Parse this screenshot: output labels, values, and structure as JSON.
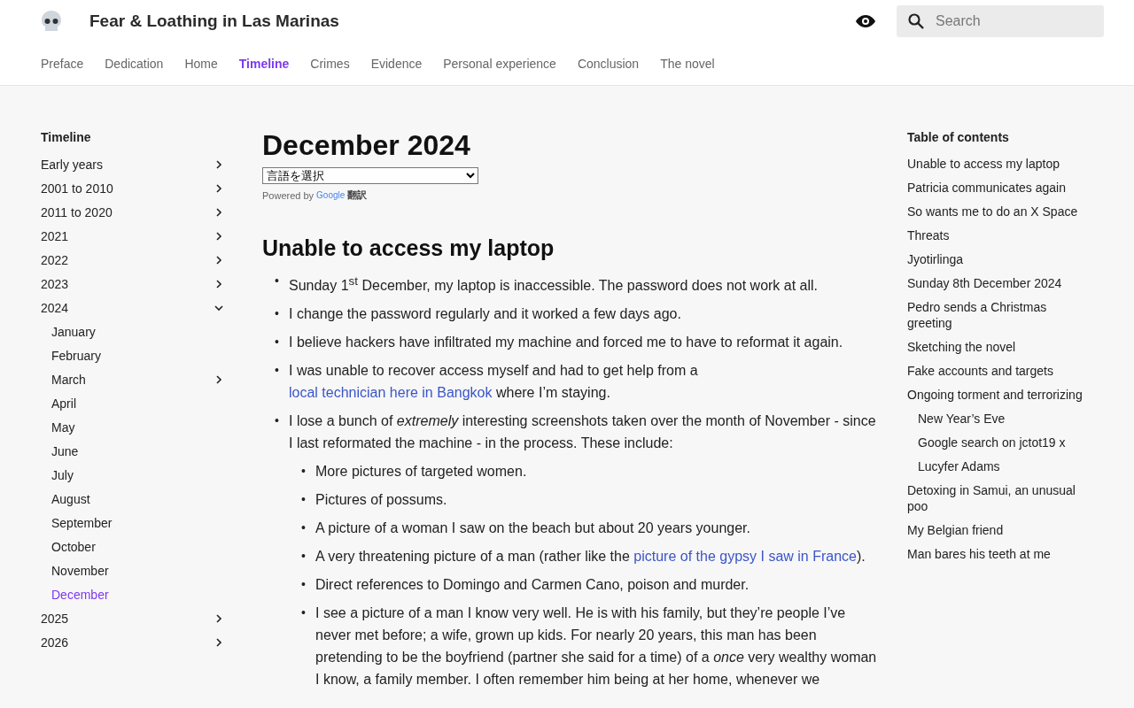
{
  "site": {
    "title": "Fear & Loathing in Las Marinas",
    "search": {
      "placeholder": "Search"
    }
  },
  "nav": [
    {
      "label": "Preface",
      "selected": false
    },
    {
      "label": "Dedication",
      "selected": false
    },
    {
      "label": "Home",
      "selected": false
    },
    {
      "label": "Timeline",
      "selected": true
    },
    {
      "label": "Crimes",
      "selected": false
    },
    {
      "label": "Evidence",
      "selected": false
    },
    {
      "label": "Personal experience",
      "selected": false
    },
    {
      "label": "Conclusion",
      "selected": false
    },
    {
      "label": "The novel",
      "selected": false
    }
  ],
  "sidebar": {
    "title": "Timeline",
    "items": [
      {
        "label": "Early years",
        "expanded": false,
        "selected": false
      },
      {
        "label": "2001 to 2010",
        "expanded": false,
        "selected": false
      },
      {
        "label": "2011 to 2020",
        "expanded": false,
        "selected": false
      },
      {
        "label": "2021",
        "expanded": false,
        "selected": false
      },
      {
        "label": "2022",
        "expanded": false,
        "selected": false
      },
      {
        "label": "2023",
        "expanded": false,
        "selected": false
      },
      {
        "label": "2024",
        "expanded": true,
        "selected": false,
        "children": [
          {
            "label": "January",
            "selected": false
          },
          {
            "label": "February",
            "selected": false
          },
          {
            "label": "March",
            "expanded": false,
            "selected": false
          },
          {
            "label": "April",
            "selected": false
          },
          {
            "label": "May",
            "selected": false
          },
          {
            "label": "June",
            "selected": false
          },
          {
            "label": "July",
            "selected": false
          },
          {
            "label": "August",
            "selected": false
          },
          {
            "label": "September",
            "selected": false
          },
          {
            "label": "October",
            "selected": false
          },
          {
            "label": "November",
            "selected": false
          },
          {
            "label": "December",
            "selected": true
          }
        ]
      },
      {
        "label": "2025",
        "expanded": false,
        "selected": false
      },
      {
        "label": "2026",
        "expanded": false,
        "selected": false
      }
    ]
  },
  "article": {
    "title": "December 2024",
    "translate": {
      "select": "言語を選択",
      "powered_by": "Powered by",
      "google": "Google",
      "translate_label": "翻訳"
    },
    "section_title": "Unable to access my laptop",
    "bullets": [
      {
        "marker": "•",
        "parts": [
          {
            "kind": "text",
            "text": "Sunday 1$^{st}$ December, my laptop is inaccessible. The password does not work at all."
          }
        ]
      },
      {
        "marker": "•",
        "parts": [
          {
            "kind": "text",
            "text": "I change the password regularly and it worked a few days ago."
          }
        ]
      },
      {
        "marker": "•",
        "parts": [
          {
            "kind": "text",
            "text": "I believe hackers have infiltrated my machine and forced me to have to reformat it again."
          }
        ]
      },
      {
        "marker": "•",
        "parts": [
          {
            "kind": "text",
            "text": "I was unable to recover access myself and had to get help from a"
          },
          {
            "kind": "link",
            "text": "local technician here in Bangkok"
          },
          {
            "kind": "text",
            "text": "where I’m staying."
          }
        ]
      },
      {
        "marker": "•",
        "parts": [
          {
            "kind": "text",
            "text": "I lose a bunch of *extremely* interesting screenshots taken over the month of November - since I last reformated the machine - in the process. These include:"
          }
        ],
        "children": [
          {
            "marker": "•",
            "parts": [
              {
                "kind": "text",
                "text": "More pictures of targeted women."
              }
            ]
          },
          {
            "marker": "•",
            "parts": [
              {
                "kind": "text",
                "text": "Pictures of possums."
              }
            ]
          },
          {
            "marker": "•",
            "parts": [
              {
                "kind": "text",
                "text": "A picture of a woman I saw on the beach but about 20 years younger."
              }
            ]
          },
          {
            "marker": "•",
            "parts": [
              {
                "kind": "text",
                "text": "A very threatening picture of a man (rather like the"
              },
              {
                "kind": "link",
                "text": "picture of the gypsy I saw in France"
              },
              {
                "kind": "text",
                "text": ")."
              }
            ]
          },
          {
            "marker": "•",
            "parts": [
              {
                "kind": "text",
                "text": "Direct references to Domingo and Carmen Cano, poison and murder."
              }
            ]
          },
          {
            "marker": "•",
            "parts": [
              {
                "kind": "text",
                "text": "I see a picture of a man I know very well. He is with his family, but they’re people I’ve never met before; a wife, grown up kids. For nearly 20 years, this man has been pretending to be the boyfriend (partner she said for a time) of a *once* very wealthy woman I know, a family member. I often remember him being at her home, whenever we"
              }
            ]
          }
        ]
      }
    ]
  },
  "toc": {
    "title": "Table of contents",
    "items": [
      {
        "label": "Unable to access my laptop"
      },
      {
        "label": "Patricia communicates again"
      },
      {
        "label": "So wants me to do an X Space"
      },
      {
        "label": "Threats"
      },
      {
        "label": "Jyotirlinga"
      },
      {
        "label": "Sunday 8th December 2024"
      },
      {
        "label": "Pedro sends a Christmas greeting"
      },
      {
        "label": "Sketching the novel"
      },
      {
        "label": "Fake accounts and targets"
      },
      {
        "label": "Ongoing torment and terrorizing",
        "children": [
          {
            "label": "New Year’s Eve"
          },
          {
            "label": "Google search on jctot19 x"
          },
          {
            "label": "Lucyfer Adams"
          }
        ]
      },
      {
        "label": "Detoxing in Samui, an unusual poo"
      },
      {
        "label": "My Belgian friend"
      },
      {
        "label": "Man bares his teeth at me"
      }
    ]
  }
}
